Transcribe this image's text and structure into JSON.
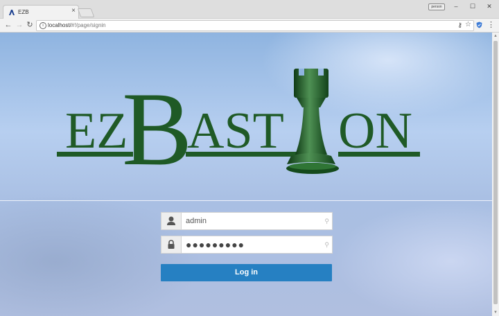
{
  "browser": {
    "tab_title": "EZB",
    "tab_close": "×",
    "profile": "person",
    "url_host": "localhost/",
    "url_path": "#!/page/signin",
    "window_controls": {
      "minimize": "–",
      "maximize": "☐",
      "close": "✕"
    },
    "icons": [
      "back-icon",
      "forward-icon",
      "reload-icon",
      "info-icon",
      "key-icon",
      "star-icon",
      "shield-icon",
      "menu-icon"
    ]
  },
  "logo": {
    "text_left": "EZ",
    "text_big": "B",
    "text_mid": "AST",
    "text_right": "ON",
    "color": "#1f5a26"
  },
  "login": {
    "username_value": "admin",
    "password_mask": "●●●●●●●●●",
    "button_label": "Log in",
    "button_color": "#2680c2"
  }
}
